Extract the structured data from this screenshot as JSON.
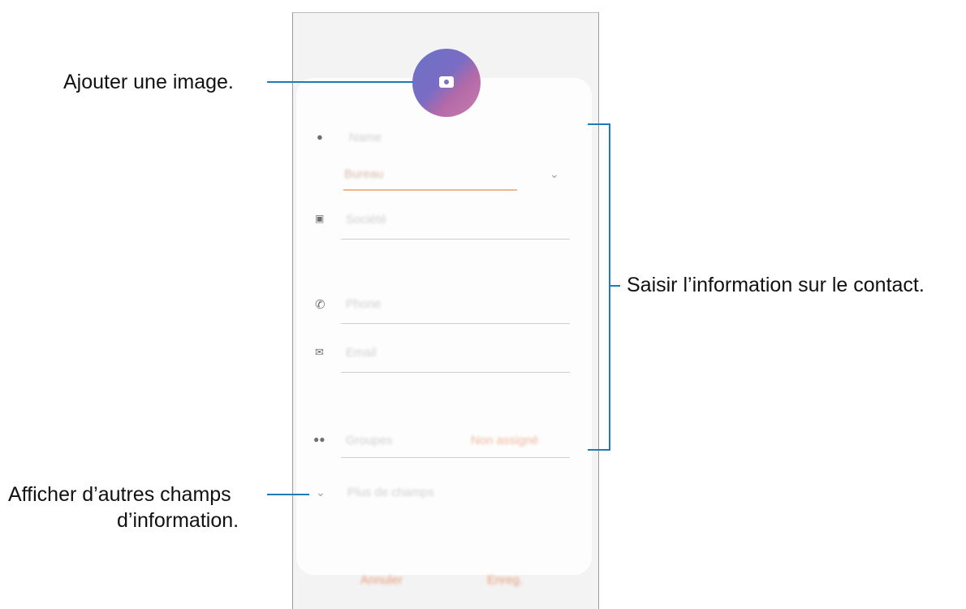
{
  "form": {
    "name_field_placeholder": "Name",
    "storage_value": "Bureau",
    "company_placeholder": "Société",
    "phone_placeholder": "Phone",
    "email_placeholder": "Email",
    "groups_label": "Groupes",
    "groups_action": "Non assigné",
    "more_fields": "Plus de champs",
    "cancel_button": "Annuler",
    "save_button": "Enreg."
  },
  "annotations": {
    "add_image": "Ajouter une image.",
    "enter_contact_info": "Saisir l’information sur le contact.",
    "show_more_fields_line1": "Afficher d’autres champs",
    "show_more_fields_line2": "d’information."
  },
  "colors": {
    "callout": "#1f7bb8",
    "accent_orange": "#e89a74",
    "avatar_start": "#6a72c4",
    "avatar_end": "#c77cae"
  }
}
